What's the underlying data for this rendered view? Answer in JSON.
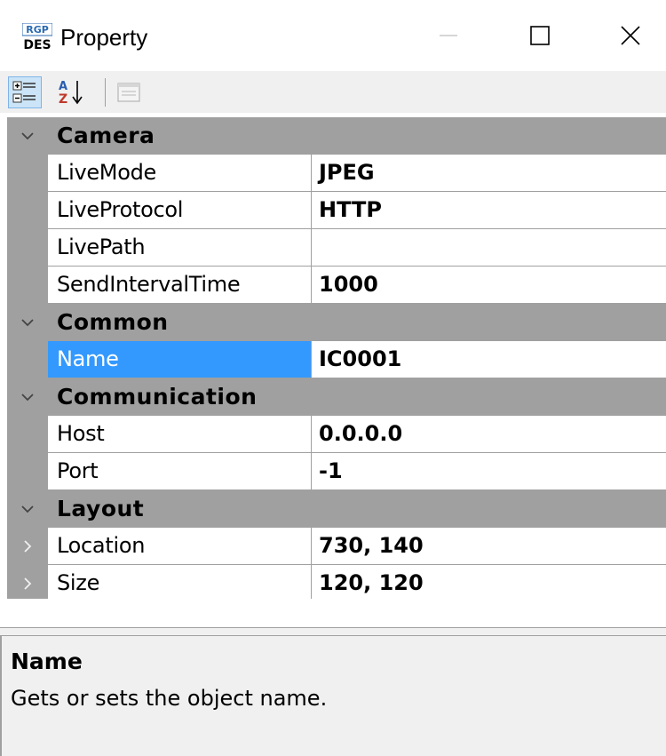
{
  "window": {
    "title": "Property",
    "icon_name": "app-icon",
    "icon_top_text": "RGP",
    "icon_bottom_text": "DES"
  },
  "toolbar": {
    "categorized_icon": "categorized-icon",
    "alphabetical_icon": "alphabetical-icon",
    "property_pages_icon": "property-pages-icon"
  },
  "colors": {
    "category_bg": "#a0a0a0",
    "selection": "#3399ff",
    "toolbar_bg": "#f0f0f0"
  },
  "categories": [
    {
      "label": "Camera",
      "expanded": true,
      "properties": [
        {
          "name": "LiveMode",
          "value": "JPEG"
        },
        {
          "name": "LiveProtocol",
          "value": "HTTP"
        },
        {
          "name": "LivePath",
          "value": ""
        },
        {
          "name": "SendIntervalTime",
          "value": "1000"
        }
      ]
    },
    {
      "label": "Common",
      "expanded": true,
      "properties": [
        {
          "name": "Name",
          "value": "IC0001",
          "selected": true
        }
      ]
    },
    {
      "label": "Communication",
      "expanded": true,
      "properties": [
        {
          "name": "Host",
          "value": "0.0.0.0"
        },
        {
          "name": "Port",
          "value": "-1"
        }
      ]
    },
    {
      "label": "Layout",
      "expanded": true,
      "properties": [
        {
          "name": "Location",
          "value": "730, 140",
          "expandable": true
        },
        {
          "name": "Size",
          "value": "120, 120",
          "expandable": true
        }
      ]
    }
  ],
  "help": {
    "title": "Name",
    "description": "Gets or sets the object name."
  }
}
